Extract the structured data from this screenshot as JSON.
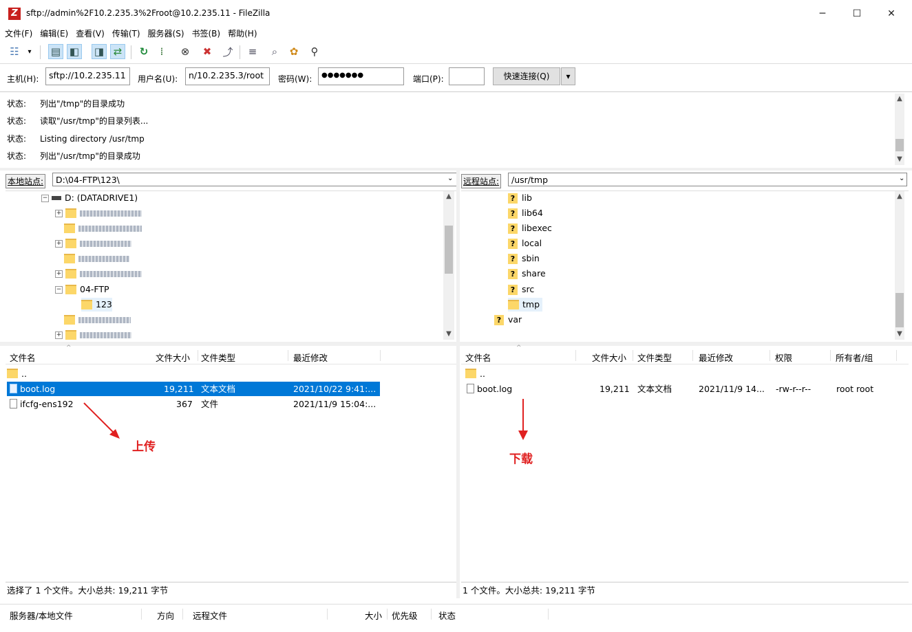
{
  "window": {
    "title": "sftp://admin%2F10.2.235.3%2Froot@10.2.235.11 - FileZilla",
    "app_icon": "Z",
    "minimize": "─",
    "maximize": "☐",
    "close": "✕"
  },
  "menu": [
    "文件(F)",
    "编辑(E)",
    "查看(V)",
    "传输(T)",
    "服务器(S)",
    "书签(B)",
    "帮助(H)"
  ],
  "toolbar_icons": [
    "site-manager-icon",
    "dropdown-icon",
    "message-log-toggle-icon",
    "local-tree-toggle-icon",
    "remote-tree-toggle-icon",
    "transfer-queue-toggle-icon",
    "refresh-icon",
    "process-queue-icon",
    "cancel-icon",
    "disconnect-icon",
    "reconnect-icon",
    "filter-icon",
    "compare-icon",
    "sync-browse-icon",
    "search-icon"
  ],
  "quickconnect": {
    "host_label": "主机(H):",
    "host_value": "sftp://10.2.235.11",
    "user_label": "用户名(U):",
    "user_value": "n/10.2.235.3/root",
    "pass_label": "密码(W):",
    "pass_value": "●●●●●●●",
    "port_label": "端口(P):",
    "port_value": "",
    "connect_button": "快速连接(Q)",
    "dropdown": "▾"
  },
  "log": [
    {
      "status": "状态:",
      "text": "列出\"/tmp\"的目录成功"
    },
    {
      "status": "状态:",
      "text": "读取\"/usr/tmp\"的目录列表..."
    },
    {
      "status": "状态:",
      "text": "Listing directory /usr/tmp"
    },
    {
      "status": "状态:",
      "text": "列出\"/usr/tmp\"的目录成功"
    }
  ],
  "local": {
    "site_label": "本地站点:",
    "path": "D:\\04-FTP\\123\\",
    "tree": {
      "drive": "D: (DATADRIVE1)",
      "folder_ftp": "04-FTP",
      "folder_123": "123"
    },
    "columns": {
      "name": "文件名",
      "size": "文件大小",
      "type": "文件类型",
      "modified": "最近修改"
    },
    "files": [
      {
        "name": "..",
        "size": "",
        "type": "",
        "modified": ""
      },
      {
        "name": "boot.log",
        "size": "19,211",
        "type": "文本文档",
        "modified": "2021/10/22 9:41:..."
      },
      {
        "name": "ifcfg-ens192",
        "size": "367",
        "type": "文件",
        "modified": "2021/11/9 15:04:..."
      }
    ],
    "status": "选择了 1 个文件。大小总共: 19,211 字节"
  },
  "remote": {
    "site_label": "远程站点:",
    "path": "/usr/tmp",
    "tree": [
      "lib",
      "lib64",
      "libexec",
      "local",
      "sbin",
      "share",
      "src",
      "tmp",
      "var"
    ],
    "unknown_glyph": "?",
    "columns": {
      "name": "文件名",
      "size": "文件大小",
      "type": "文件类型",
      "modified": "最近修改",
      "perms": "权限",
      "owner": "所有者/组"
    },
    "files": [
      {
        "name": "..",
        "size": "",
        "type": "",
        "modified": "",
        "perms": "",
        "owner": ""
      },
      {
        "name": "boot.log",
        "size": "19,211",
        "type": "文本文档",
        "modified": "2021/11/9 14...",
        "perms": "-rw-r--r--",
        "owner": "root root"
      }
    ],
    "status": "1 个文件。大小总共: 19,211 字节"
  },
  "queue": {
    "server_local": "服务器/本地文件",
    "direction": "方向",
    "remote_file": "远程文件",
    "size": "大小",
    "priority": "优先级",
    "status": "状态"
  },
  "annotations": {
    "upload": "上传",
    "download": "下载",
    "color": "#e02020"
  },
  "selection_color": "#0078d7"
}
